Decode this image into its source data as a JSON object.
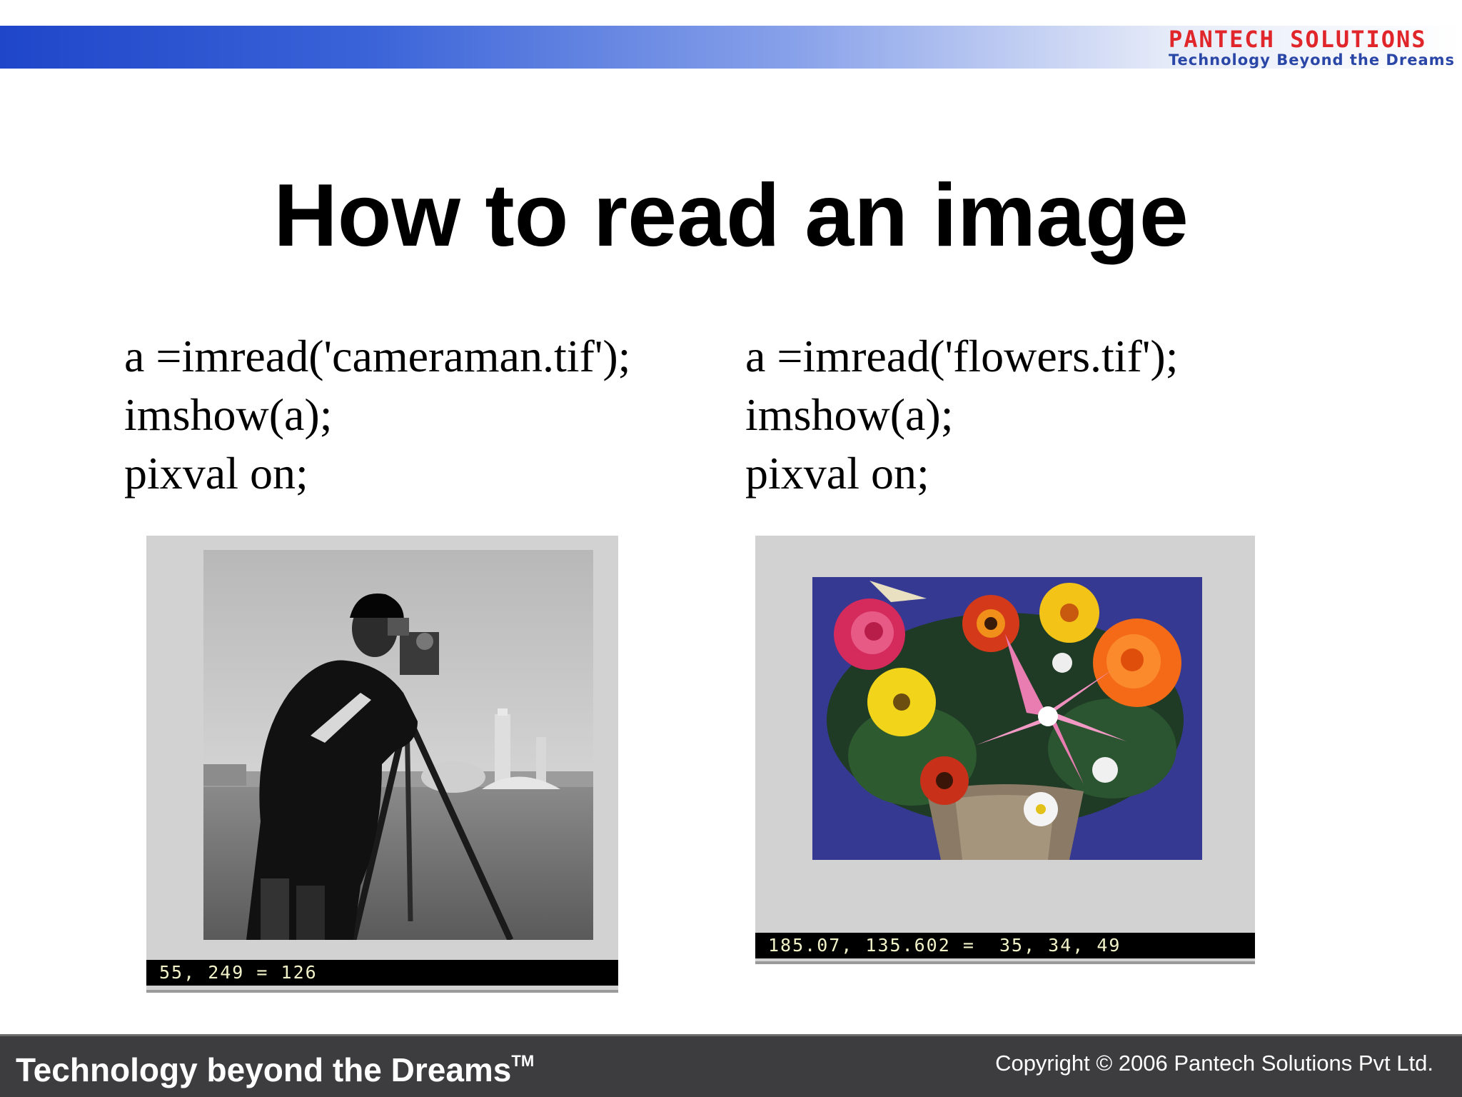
{
  "header": {
    "logo_main": "PANTECH SOLUTIONS",
    "logo_sub": "Technology Beyond the Dreams"
  },
  "slide": {
    "title": "How to read an image",
    "left_code": [
      "a =imread('cameraman.tif');",
      "imshow(a);",
      "pixval on;"
    ],
    "right_code": [
      "a =imread('flowers.tif');",
      "imshow(a);",
      "pixval on;"
    ],
    "left_pixval": "55, 249 = 126",
    "right_pixval": "185.07, 135.602 =  35, 34, 49"
  },
  "footer": {
    "tagline": "Technology beyond the Dreams",
    "trademark": "TM",
    "copyright": "Copyright © 2006 Pantech Solutions Pvt Ltd."
  }
}
